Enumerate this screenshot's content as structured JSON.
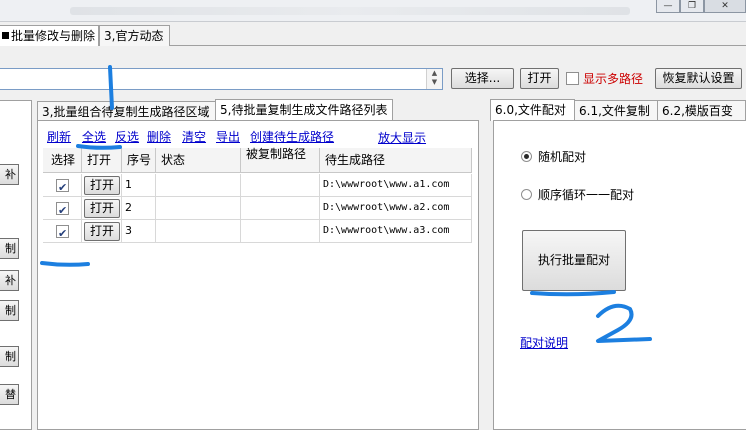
{
  "window": {
    "minimize_glyph": "—",
    "restore_glyph": "❐",
    "close_glyph": "✕"
  },
  "top_tabs": [
    {
      "label": "批量修改与删除",
      "active": true
    },
    {
      "label": "3,官方动态",
      "active": false
    }
  ],
  "toolbar": {
    "path_value": "",
    "select_label": "选择...",
    "open_label": "打开",
    "show_multi_path_label": "显示多路径",
    "show_multi_path_checked": false,
    "restore_default_label": "恢复默认设置"
  },
  "left_panel": {
    "button_fragments": [
      "补",
      "制",
      "补",
      "制",
      "制",
      "替"
    ]
  },
  "mid_tabs": [
    {
      "label": "3,批量组合待复制生成路径区域",
      "active": false
    },
    {
      "label": "5,待批量复制生成文件路径列表",
      "active": true
    }
  ],
  "actions": [
    "刷新",
    "全选",
    "反选",
    "删除",
    "清空",
    "导出",
    "创建待生成路径"
  ],
  "zoom_label": "放大显示",
  "table": {
    "columns": [
      "选择",
      "打开",
      "序号",
      "状态",
      "被复制路径",
      "待生成路径"
    ],
    "open_button_label": "打开",
    "rows": [
      {
        "checked": true,
        "index": "1",
        "status": "",
        "source": "",
        "target": "D:\\wwwroot\\www.a1.com"
      },
      {
        "checked": true,
        "index": "2",
        "status": "",
        "source": "",
        "target": "D:\\wwwroot\\www.a2.com"
      },
      {
        "checked": true,
        "index": "3",
        "status": "",
        "source": "",
        "target": "D:\\wwwroot\\www.a3.com"
      }
    ]
  },
  "right_tabs": [
    {
      "label": "6.0,文件配对",
      "active": true
    },
    {
      "label": "6.1,文件复制",
      "active": false
    },
    {
      "label": "6.2,模版百变",
      "active": false
    }
  ],
  "right_panel": {
    "radio_random_label": "随机配对",
    "radio_random_selected": true,
    "radio_sequence_label": "顺序循环一一配对",
    "radio_sequence_selected": false,
    "execute_label": "执行批量配对",
    "help_link": "配对说明"
  },
  "annotations": {
    "marker_one": "1",
    "marker_two": "2",
    "ink_color": "#1c7fe0"
  },
  "colors": {
    "link": "#0000cc",
    "warning_text": "#cc0000"
  }
}
